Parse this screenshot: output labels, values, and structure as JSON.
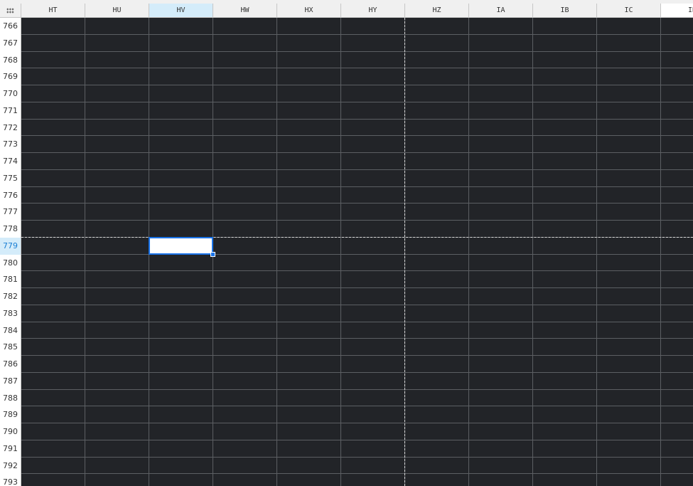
{
  "spreadsheet": {
    "columns": [
      "HT",
      "HU",
      "HV",
      "HW",
      "HX",
      "HY",
      "HZ",
      "IA",
      "IB",
      "IC",
      "ID"
    ],
    "rows": [
      "766",
      "767",
      "768",
      "769",
      "770",
      "771",
      "772",
      "773",
      "774",
      "775",
      "776",
      "777",
      "778",
      "779",
      "780",
      "781",
      "782",
      "783",
      "784",
      "785",
      "786",
      "787",
      "788",
      "789",
      "790",
      "791",
      "792",
      "793"
    ],
    "selected_column": "HV",
    "selected_row": "779",
    "active_cell": {
      "column": "HV",
      "row": "779",
      "value": ""
    },
    "colors": {
      "cell_background": "#222428",
      "grid_line": "#5c5f63",
      "selection_accent": "#1a73e8",
      "header_selected": "#d4ecfa"
    },
    "icons": {
      "corner": "select-all-grid-icon"
    }
  }
}
